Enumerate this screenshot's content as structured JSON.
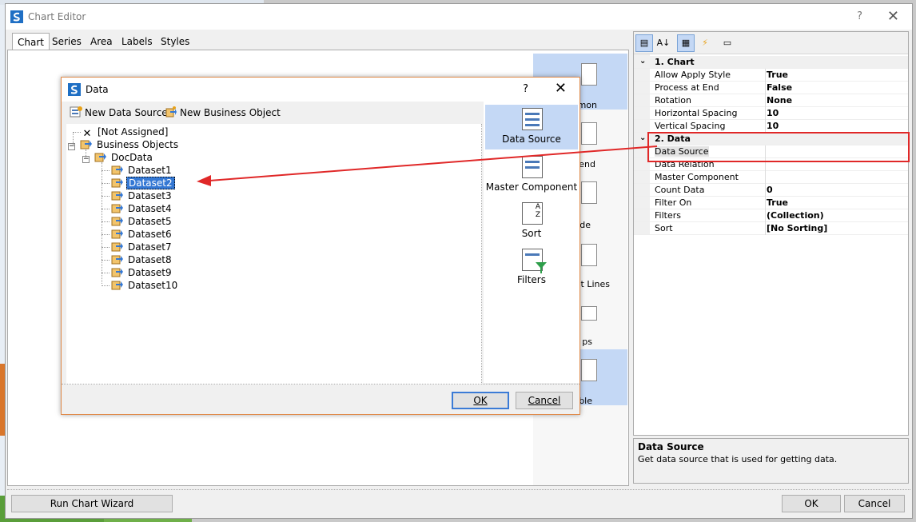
{
  "window": {
    "title": "Chart Editor",
    "help_glyph": "?",
    "close_glyph": "✕"
  },
  "tabs": [
    "Chart",
    "Series",
    "Area",
    "Labels",
    "Styles"
  ],
  "gallery": {
    "items": [
      {
        "label": "mon",
        "selected": true
      },
      {
        "label": "end",
        "selected": false
      },
      {
        "label": "de",
        "selected": false
      },
      {
        "label": "nt Lines",
        "selected": false
      },
      {
        "label": "ps",
        "selected": false
      },
      {
        "label": "ble",
        "selected": true
      }
    ]
  },
  "property_grid": {
    "toolbar": [
      "categorized-icon",
      "alphabetical-icon",
      "properties-icon",
      "events-icon",
      "pages-icon"
    ],
    "categories": [
      {
        "name": "1. Chart",
        "rows": [
          {
            "name": "Allow Apply Style",
            "value": "True"
          },
          {
            "name": "Process at End",
            "value": "False"
          },
          {
            "name": "Rotation",
            "value": "None"
          },
          {
            "name": "Horizontal Spacing",
            "value": "10"
          },
          {
            "name": "Vertical Spacing",
            "value": "10"
          }
        ]
      },
      {
        "name": "2. Data",
        "rows": [
          {
            "name": "Data Source",
            "value": ""
          },
          {
            "name": "Data Relation",
            "value": ""
          },
          {
            "name": "Master Component",
            "value": ""
          },
          {
            "name": "Count Data",
            "value": "0"
          },
          {
            "name": "Filter On",
            "value": "True"
          },
          {
            "name": "Filters",
            "value": "(Collection)"
          },
          {
            "name": "Sort",
            "value": "[No Sorting]"
          }
        ]
      }
    ],
    "description": {
      "title": "Data Source",
      "text": "Get data source that is used for getting data."
    }
  },
  "bottom": {
    "wizard_label": "Run Chart Wizard",
    "ok_label": "OK",
    "cancel_label": "Cancel"
  },
  "data_dialog": {
    "title": "Data",
    "help_glyph": "?",
    "close_glyph": "✕",
    "toolbar": {
      "new_data_source": "New Data Source",
      "new_business_object": "New Business Object"
    },
    "tree": {
      "not_assigned": "[Not Assigned]",
      "business_objects": "Business Objects",
      "doc_data": "DocData",
      "datasets": [
        "Dataset1",
        "Dataset2",
        "Dataset3",
        "Dataset4",
        "Dataset5",
        "Dataset6",
        "Dataset7",
        "Dataset8",
        "Dataset9",
        "Dataset10"
      ],
      "selected": "Dataset2"
    },
    "side_panel": [
      {
        "label": "Data Source",
        "selected": true
      },
      {
        "label": "Master Component",
        "selected": false
      },
      {
        "label": "Sort",
        "selected": false
      },
      {
        "label": "Filters",
        "selected": false
      }
    ],
    "ok_label": "OK",
    "cancel_label": "Cancel"
  },
  "colors": {
    "selection": "#c4d8f5",
    "tree_selection": "#3478d4",
    "highlight_red": "#e02828",
    "dialog_border": "#e08a4a"
  }
}
